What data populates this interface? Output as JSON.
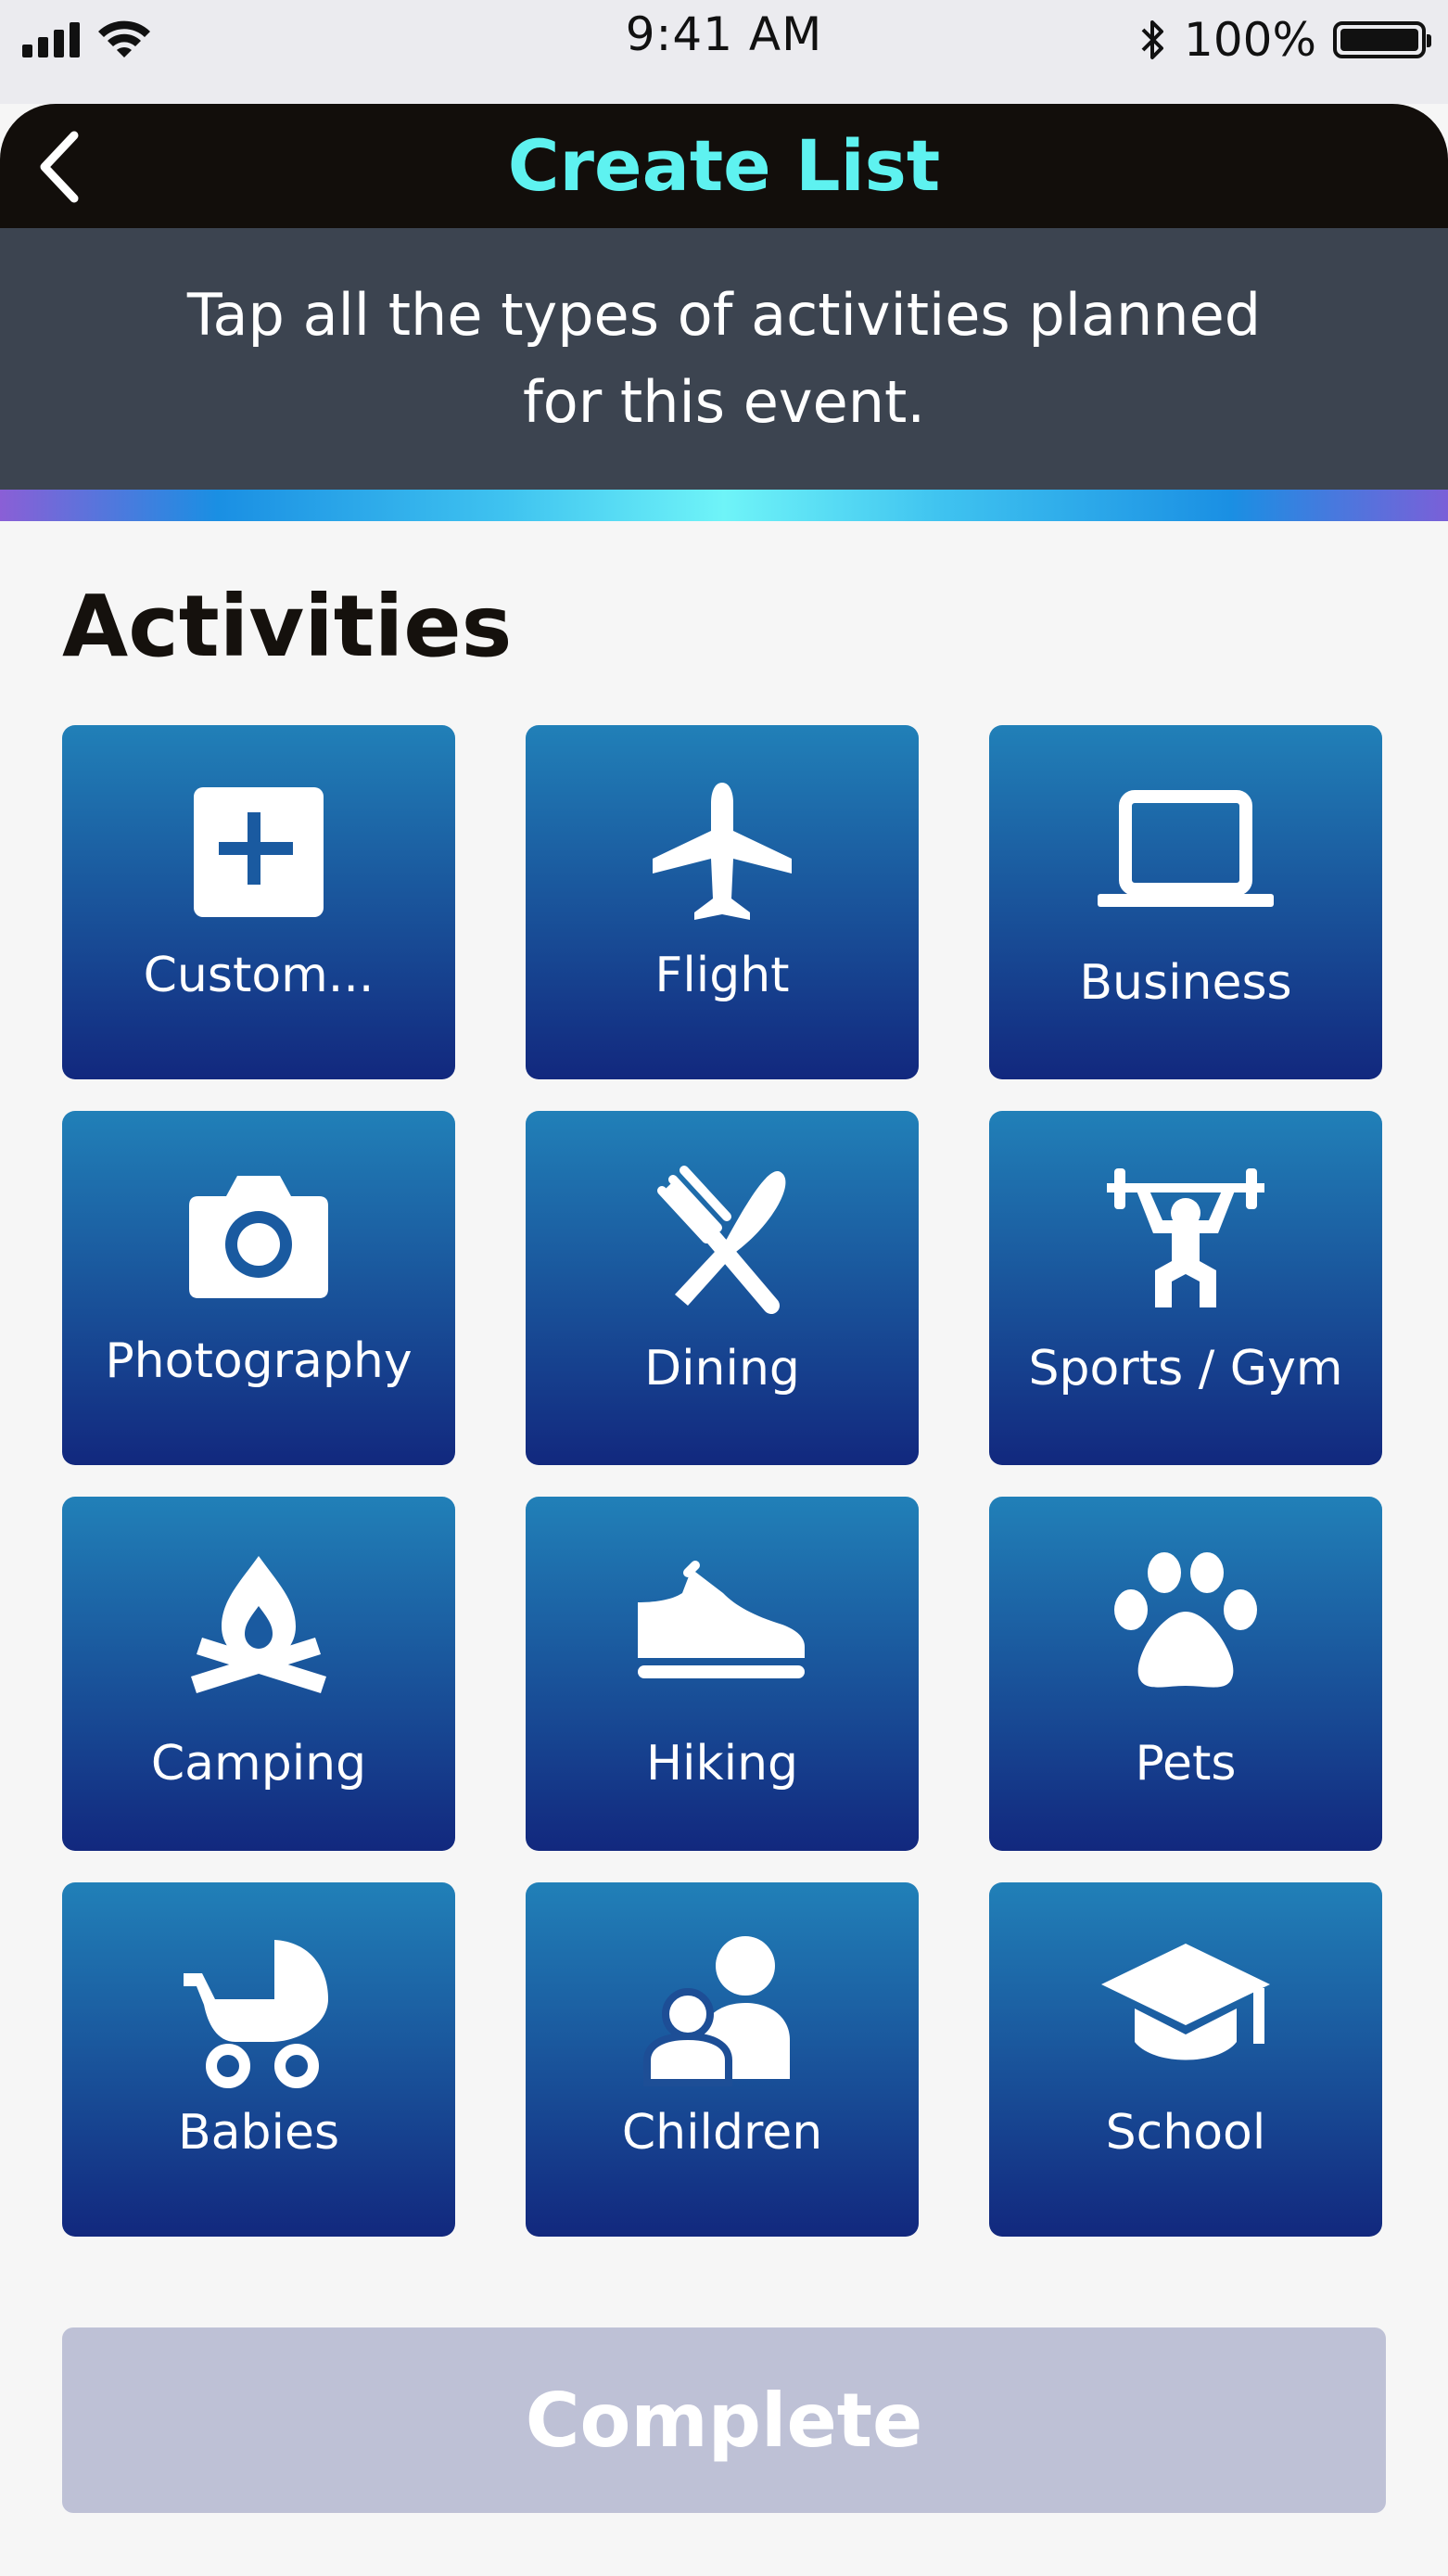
{
  "status_bar": {
    "time": "9:41 AM",
    "battery": "100%",
    "battery_level": 1.0
  },
  "nav": {
    "title": "Create List",
    "back_icon": "chevron-left-icon"
  },
  "instruction": "Tap all the types of activities planned for this event.",
  "section_title": "Activities",
  "tiles": [
    {
      "label": "Custom...",
      "icon": "plus-square-icon"
    },
    {
      "label": "Flight",
      "icon": "airplane-icon"
    },
    {
      "label": "Business",
      "icon": "laptop-icon"
    },
    {
      "label": "Photography",
      "icon": "camera-icon"
    },
    {
      "label": "Dining",
      "icon": "fork-knife-icon"
    },
    {
      "label": "Sports / Gym",
      "icon": "weightlifter-icon"
    },
    {
      "label": "Camping",
      "icon": "campfire-icon"
    },
    {
      "label": "Hiking",
      "icon": "shoe-icon"
    },
    {
      "label": "Pets",
      "icon": "paw-icon"
    },
    {
      "label": "Babies",
      "icon": "stroller-icon"
    },
    {
      "label": "Children",
      "icon": "parent-child-icon"
    },
    {
      "label": "School",
      "icon": "graduation-cap-icon"
    }
  ],
  "complete_label": "Complete",
  "colors": {
    "nav_title": "#5ef2f0",
    "tile_top": "#2180b8",
    "tile_bottom": "#12287e",
    "complete_disabled": "#bec1d6"
  }
}
